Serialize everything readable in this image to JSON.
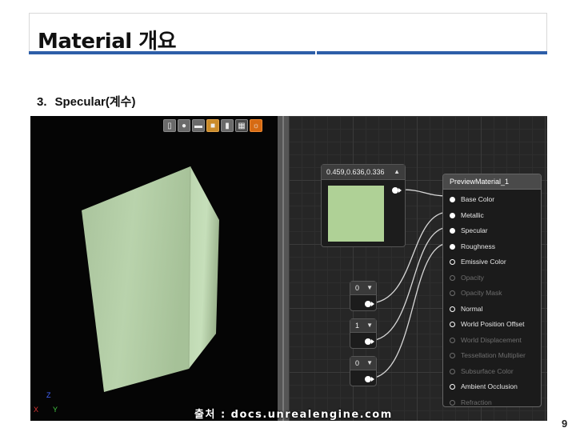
{
  "slide": {
    "title": "Material 개요",
    "item_number": "3.",
    "item_text": "Specular(계수)",
    "page_number": "9"
  },
  "viewport": {
    "credit": "출처 : docs.unrealengine.com",
    "axis_labels": {
      "x": "X",
      "y": "Y",
      "z": "Z"
    },
    "toolbar_icons": [
      "mesh-icon",
      "sphere-icon",
      "plane-icon",
      "cube-icon",
      "cylinder-icon",
      "mesh-select-icon",
      "light-icon"
    ],
    "cube_color": "#b3cfa5"
  },
  "graph": {
    "color_node": {
      "label": "0.459,0.636,0.336",
      "swatch_color": "#afd196"
    },
    "constants": [
      {
        "value": "0"
      },
      {
        "value": "1"
      },
      {
        "value": "0"
      }
    ],
    "preview": {
      "title": "PreviewMaterial_1",
      "pins": [
        {
          "label": "Base Color",
          "state": "filled"
        },
        {
          "label": "Metallic",
          "state": "filled"
        },
        {
          "label": "Specular",
          "state": "filled"
        },
        {
          "label": "Roughness",
          "state": "filled"
        },
        {
          "label": "Emissive Color",
          "state": "open"
        },
        {
          "label": "Opacity",
          "state": "disabled"
        },
        {
          "label": "Opacity Mask",
          "state": "disabled"
        },
        {
          "label": "Normal",
          "state": "open"
        },
        {
          "label": "World Position Offset",
          "state": "open"
        },
        {
          "label": "World Displacement",
          "state": "disabled"
        },
        {
          "label": "Tessellation Multiplier",
          "state": "disabled"
        },
        {
          "label": "Subsurface Color",
          "state": "disabled"
        },
        {
          "label": "Ambient Occlusion",
          "state": "open"
        },
        {
          "label": "Refraction",
          "state": "disabled"
        }
      ]
    }
  }
}
